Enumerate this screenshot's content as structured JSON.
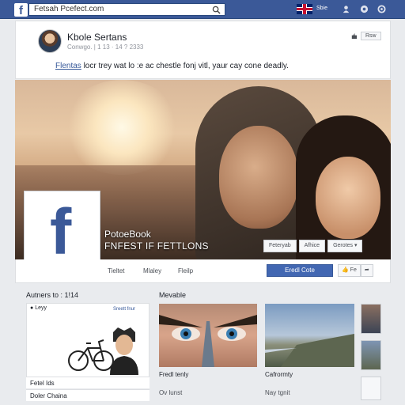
{
  "topbar": {
    "logo": "f",
    "search_value": "Fetsah Pcefect.com",
    "nav_text": "Sbie"
  },
  "post": {
    "name": "Kbole Sertans",
    "meta": "Conwgo. | 1 13 · 14 ? 2333",
    "link_text": "Flentas",
    "body": " locr trey wat lo :e ac chestle fonj vitl, yaur cay cone deadly.",
    "follow_label": "Rsw"
  },
  "page": {
    "name": "PotoeBook",
    "subtitle": "FNFEST IF FETTLONS",
    "cover_buttons": [
      "Feteryab",
      "Afhice",
      "Gerotes"
    ]
  },
  "tabs": [
    "Tieltet",
    "Mlaley",
    "Fleilp"
  ],
  "actions": {
    "contact": "Eredl Cote",
    "like": "Fe"
  },
  "left": {
    "title": "Autners to : 1!14",
    "card_head": "Leyy",
    "card_link": "Sreett fnur",
    "items": [
      "Fetel Ids",
      "Doler Chaina"
    ]
  },
  "middle": {
    "title": "Mevable",
    "tile1_caption": "Fredl tenly",
    "tile2_caption": "Cafrormty",
    "more1": "Ov lunst",
    "more2": "Nay tgnit"
  },
  "colors": {
    "brand": "#3b5998",
    "button": "#4267b2"
  }
}
